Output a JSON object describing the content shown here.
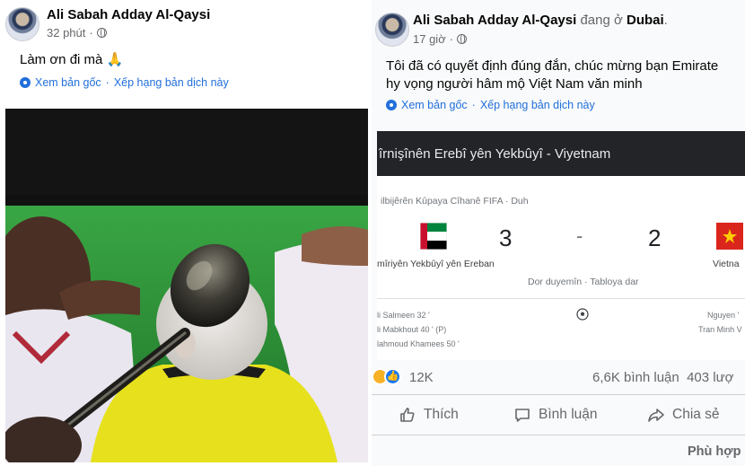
{
  "left_post": {
    "author": "Ali Sabah Adday Al-Qaysi",
    "time": "32 phút",
    "dot": "·",
    "text": "Làm ơn đi mà 🙏",
    "see_original": "Xem bản gốc",
    "rate_translation": "Xếp hạng bản dịch này"
  },
  "right_post": {
    "author": "Ali Sabah Adday Al-Qaysi",
    "location_prefix": "đang ở",
    "location": "Dubai",
    "location_suffix": ".",
    "time": "17 giờ",
    "dot": "·",
    "text_line1": "Tôi đã có quyết định đúng đắn, chúc mừng bạn Emirate",
    "text_line2": "hy vọng người hâm mộ Việt Nam văn minh",
    "see_original": "Xem bản gốc",
    "rate_translation": "Xếp hạng bản dịch này",
    "match_card": {
      "header": "îrnişînên Erebî yên Yekbûyî - Viyetnam",
      "competition": "ilbijêrên Kûpaya Cîhanê FIFA · Duh",
      "home_score": "3",
      "score_dash": "-",
      "away_score": "2",
      "home_team": "mîriyên Yekbûyî yên Ereban",
      "away_team": "Vietna",
      "status": "Dor duyemîn · Tabloya dar",
      "home_scorers": [
        "li Salmeen 32 '",
        "li Mabkhout 40 ' (P)",
        "lahmoud Khamees 50 '"
      ],
      "away_scorers": [
        "Nguyen '",
        "Tran Minh V"
      ]
    },
    "reactions_count": "12K",
    "comments_count": "6,6K bình luận",
    "shares_count": "403 lượ",
    "actions": {
      "like": "Thích",
      "comment": "Bình luận",
      "share": "Chia sẻ"
    },
    "footer": "Phù hợp"
  },
  "colors": {
    "link_blue": "#216fdb",
    "facebook_blue": "#1877f2",
    "gray_text": "#65676b",
    "referee_yellow": "#e6e11c",
    "pitch_green": "#2f9b3c"
  },
  "icons": [
    "globe-icon",
    "gear-icon",
    "like-icon",
    "haha-icon",
    "comment-icon",
    "share-icon",
    "football-icon",
    "uae-flag-icon",
    "vietnam-flag-icon"
  ]
}
